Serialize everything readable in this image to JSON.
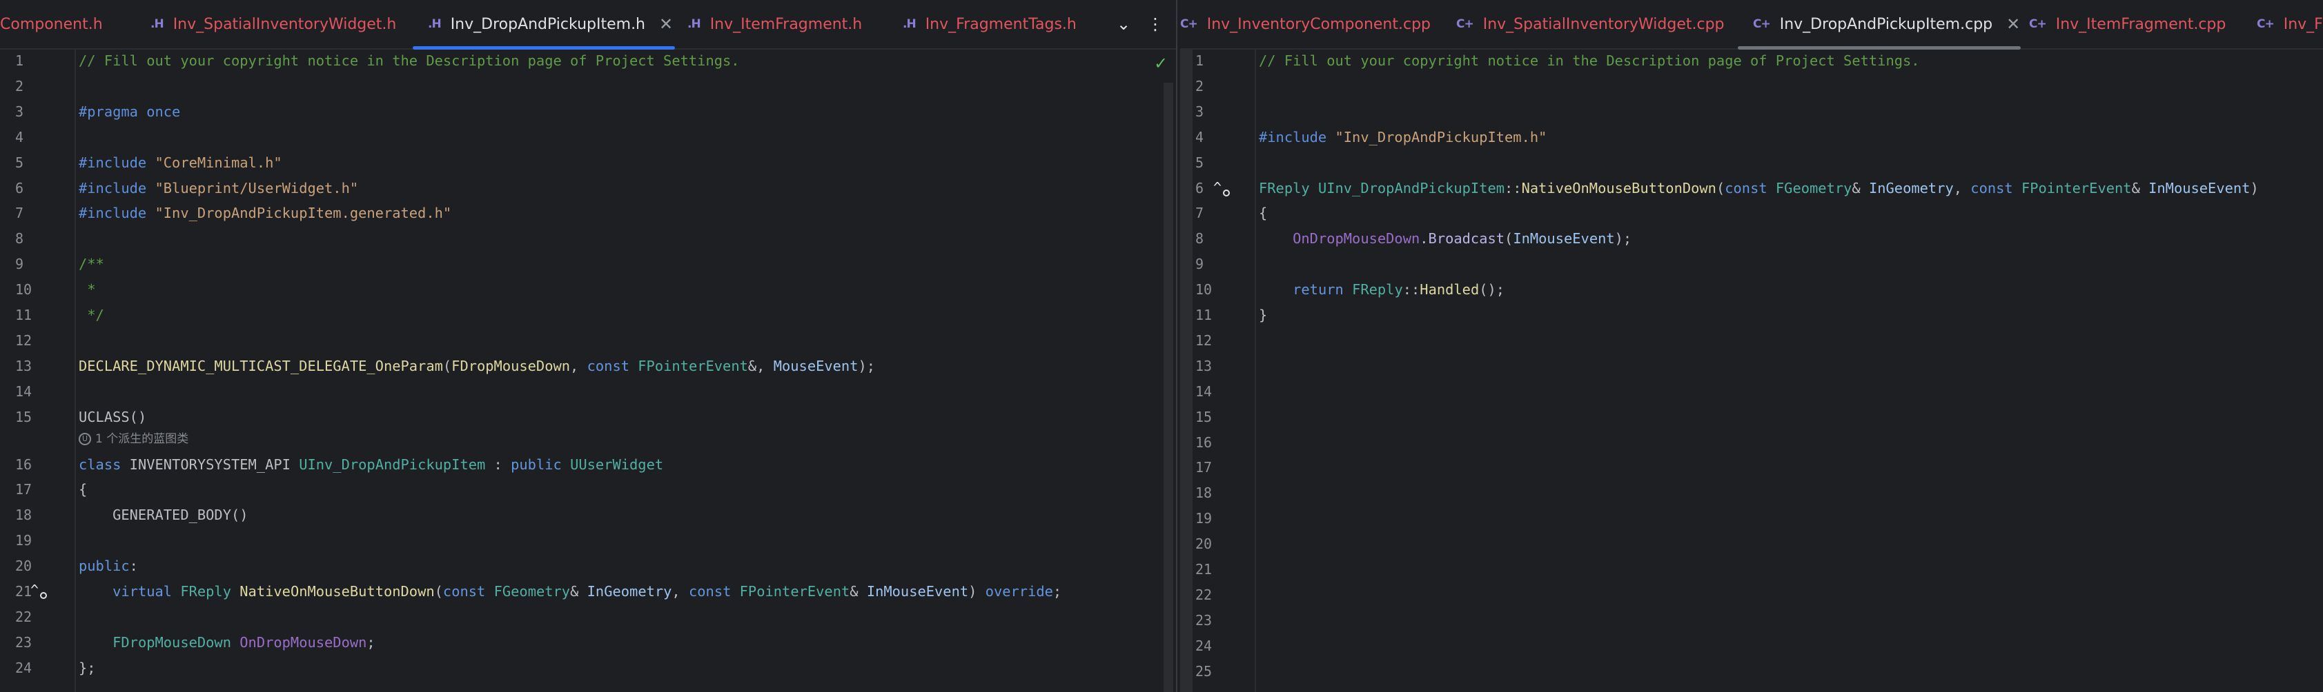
{
  "left_pane": {
    "tabs": [
      {
        "ext": "",
        "label": "Component.h",
        "active": false
      },
      {
        "ext": ".H",
        "label": "Inv_SpatialInventoryWidget.h",
        "active": false
      },
      {
        "ext": ".H",
        "label": "Inv_DropAndPickupItem.h",
        "active": true
      },
      {
        "ext": ".H",
        "label": "Inv_ItemFragment.h",
        "active": false
      },
      {
        "ext": ".H",
        "label": "Inv_FragmentTags.h",
        "active": false
      }
    ],
    "close_glyph": "✕",
    "dropdown_glyph": "⌄",
    "more_glyph": "⋮",
    "status_glyph": "✓",
    "hint_text": "1 个派生的蓝图类",
    "hint_badge": "U",
    "line_numbers": [
      "1",
      "2",
      "3",
      "4",
      "5",
      "6",
      "7",
      "8",
      "9",
      "10",
      "11",
      "12",
      "13",
      "14",
      "15",
      "16",
      "17",
      "18",
      "19",
      "20",
      "21",
      "22",
      "23",
      "24"
    ]
  },
  "right_pane": {
    "tabs": [
      {
        "ext": "C+",
        "label": "Inv_InventoryComponent.cpp",
        "active": false
      },
      {
        "ext": "C+",
        "label": "Inv_SpatialInventoryWidget.cpp",
        "active": false
      },
      {
        "ext": "C+",
        "label": "Inv_DropAndPickupItem.cpp",
        "active": true
      },
      {
        "ext": "C+",
        "label": "Inv_ItemFragment.cpp",
        "active": false
      },
      {
        "ext": "C+",
        "label": "Inv_Fr",
        "active": false
      }
    ],
    "close_glyph": "✕",
    "line_numbers": [
      "1",
      "2",
      "3",
      "4",
      "5",
      "6",
      "7",
      "8",
      "9",
      "10",
      "11",
      "12",
      "13",
      "14",
      "15",
      "16",
      "17",
      "18",
      "19",
      "20",
      "21",
      "22",
      "23",
      "24",
      "25"
    ]
  },
  "left_code": [
    [
      {
        "t": "// Fill out your copyright notice in the Description page of Project Settings.",
        "c": "cm"
      }
    ],
    [],
    [
      {
        "t": "#pragma",
        "c": "pp"
      },
      {
        "t": " "
      },
      {
        "t": "once",
        "c": "pp"
      }
    ],
    [],
    [
      {
        "t": "#include",
        "c": "pp"
      },
      {
        "t": " "
      },
      {
        "t": "\"CoreMinimal.h\"",
        "c": "str"
      }
    ],
    [
      {
        "t": "#include",
        "c": "pp"
      },
      {
        "t": " "
      },
      {
        "t": "\"Blueprint/UserWidget.h\"",
        "c": "str"
      }
    ],
    [
      {
        "t": "#include",
        "c": "pp"
      },
      {
        "t": " "
      },
      {
        "t": "\"Inv_DropAndPickupItem.generated.h\"",
        "c": "str"
      }
    ],
    [],
    [
      {
        "t": "/**",
        "c": "cm"
      }
    ],
    [
      {
        "t": " *",
        "c": "cm"
      }
    ],
    [
      {
        "t": " */",
        "c": "cm"
      }
    ],
    [],
    [
      {
        "t": "DECLARE_DYNAMIC_MULTICAST_DELEGATE_OneParam",
        "c": "fn"
      },
      {
        "t": "("
      },
      {
        "t": "FDropMouseDown",
        "c": "fn"
      },
      {
        "t": ", "
      },
      {
        "t": "const",
        "c": "kw"
      },
      {
        "t": " "
      },
      {
        "t": "FPointerEvent",
        "c": "ty"
      },
      {
        "t": "&, "
      },
      {
        "t": "MouseEvent",
        "c": "pa"
      },
      {
        "t": ");"
      }
    ],
    [],
    [
      {
        "t": "UCLASS",
        "c": "df"
      },
      {
        "t": "()"
      }
    ],
    [
      {
        "t": "class",
        "c": "kw"
      },
      {
        "t": " INVENTORYSYSTEM_API "
      },
      {
        "t": "UInv_DropAndPickupItem",
        "c": "ty"
      },
      {
        "t": " : "
      },
      {
        "t": "public",
        "c": "kw"
      },
      {
        "t": " "
      },
      {
        "t": "UUserWidget",
        "c": "ty"
      }
    ],
    [
      {
        "t": "{"
      }
    ],
    [
      {
        "t": "    GENERATED_BODY()"
      }
    ],
    [],
    [
      {
        "t": "public",
        "c": "kw"
      },
      {
        "t": ":"
      }
    ],
    [
      {
        "t": "    "
      },
      {
        "t": "virtual",
        "c": "kw"
      },
      {
        "t": " "
      },
      {
        "t": "FReply",
        "c": "ty"
      },
      {
        "t": " "
      },
      {
        "t": "NativeOnMouseButtonDown",
        "c": "fn"
      },
      {
        "t": "("
      },
      {
        "t": "const",
        "c": "kw"
      },
      {
        "t": " "
      },
      {
        "t": "FGeometry",
        "c": "ty"
      },
      {
        "t": "& "
      },
      {
        "t": "InGeometry",
        "c": "pa"
      },
      {
        "t": ", "
      },
      {
        "t": "const",
        "c": "kw"
      },
      {
        "t": " "
      },
      {
        "t": "FPointerEvent",
        "c": "ty"
      },
      {
        "t": "& "
      },
      {
        "t": "InMouseEvent",
        "c": "pa"
      },
      {
        "t": ") "
      },
      {
        "t": "override",
        "c": "kw"
      },
      {
        "t": ";"
      }
    ],
    [],
    [
      {
        "t": "    "
      },
      {
        "t": "FDropMouseDown",
        "c": "ty"
      },
      {
        "t": " "
      },
      {
        "t": "OnDropMouseDown",
        "c": "pr"
      },
      {
        "t": ";"
      }
    ],
    [
      {
        "t": "};"
      }
    ]
  ],
  "right_code": [
    [
      {
        "t": "// Fill out your copyright notice in the Description page of Project Settings.",
        "c": "cm"
      }
    ],
    [],
    [],
    [
      {
        "t": "#include",
        "c": "pp"
      },
      {
        "t": " "
      },
      {
        "t": "\"Inv_DropAndPickupItem.h\"",
        "c": "str"
      }
    ],
    [],
    [
      {
        "t": "FReply",
        "c": "ty"
      },
      {
        "t": " "
      },
      {
        "t": "UInv_DropAndPickupItem",
        "c": "ty"
      },
      {
        "t": "::"
      },
      {
        "t": "NativeOnMouseButtonDown",
        "c": "fn"
      },
      {
        "t": "("
      },
      {
        "t": "const",
        "c": "kw"
      },
      {
        "t": " "
      },
      {
        "t": "FGeometry",
        "c": "ty"
      },
      {
        "t": "& "
      },
      {
        "t": "InGeometry",
        "c": "pa"
      },
      {
        "t": ", "
      },
      {
        "t": "const",
        "c": "kw"
      },
      {
        "t": " "
      },
      {
        "t": "FPointerEvent",
        "c": "ty"
      },
      {
        "t": "& "
      },
      {
        "t": "InMouseEvent",
        "c": "pa"
      },
      {
        "t": ")"
      }
    ],
    [
      {
        "t": "{"
      }
    ],
    [
      {
        "t": "    "
      },
      {
        "t": "OnDropMouseDown",
        "c": "pr"
      },
      {
        "t": "."
      },
      {
        "t": "Broadcast",
        "c": "mf"
      },
      {
        "t": "("
      },
      {
        "t": "InMouseEvent",
        "c": "pa"
      },
      {
        "t": ");"
      }
    ],
    [],
    [
      {
        "t": "    "
      },
      {
        "t": "return",
        "c": "kw"
      },
      {
        "t": " "
      },
      {
        "t": "FReply",
        "c": "ty"
      },
      {
        "t": "::"
      },
      {
        "t": "Handled",
        "c": "fn"
      },
      {
        "t": "();"
      }
    ],
    [
      {
        "t": "}"
      }
    ],
    [],
    [],
    [],
    [],
    [],
    [],
    [],
    [],
    [],
    [],
    [],
    [],
    [],
    []
  ],
  "gutter_markers": {
    "left_line": "21",
    "right_line": "6",
    "glyph": "^"
  }
}
